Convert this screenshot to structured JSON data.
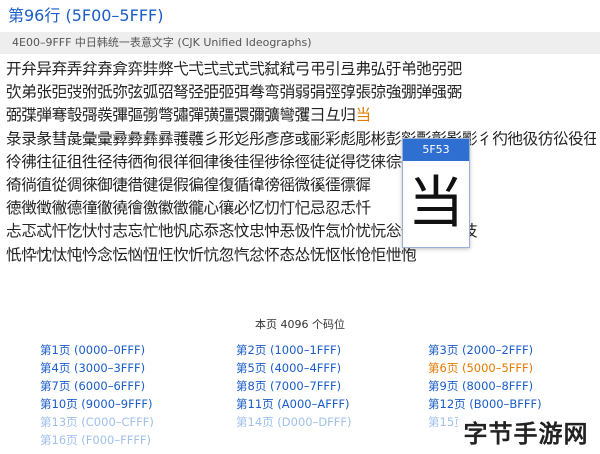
{
  "header": {
    "title": "第96行  (5F00–5FFF)",
    "subtitle": "4E00–9FFF 中日韩统一表意文字 (CJK Unified Ideographs)"
  },
  "grid": {
    "lines": [
      "开弁异弃弄弅弆弇弈弉弊弋弌弍弎式弐弑弒弓弔引弖弗弘弙弚弛弜弝",
      "弞弟张弡弢弣弤弥弦弧弨弩弪弫弬弭弮弯弰弱弲弳弴張弶強弸弹强弻",
      "弼弽弾弿彀彁彂彃彄彅彆彇彈彉彊彋彌彍彎彏彐彑归",
      "彔录彖彗彘彙彚彛彜彝彞彟彠彡形彣彤彥彦彧彨彩彪彫彬彭彮彯彰影彲彳彴彵彶彷彸役彺彻彼彽",
      "彾彿往征徂徃径待徆徇很徉徊律後徍徎徏徐徑徒従得徔徕徖得徘徙徚",
      "徛徜徝從徟徠御徢徣徤徥徦徧徨復循徫徬徭微徯徰徱徲",
      "徳徴徵徶德徸徹徺徻徼徽徾徿心忀必忆忉忊忋忌忍忎忏",
      "忐忑忒忓忔忕忖志忘忙忚忛応忝忞忟忠忡忢忣忤忥忦忧忨忩忪快忬忭忮",
      "忯忰忱忲忳忴念忶忷忸忹忺忻忼忽忾忿怀态怂怃怄怅怆怇怈怉"
    ],
    "highlight_char": "当"
  },
  "popup": {
    "code": "5F53",
    "char": "当"
  },
  "summary": {
    "count_text": "本页 4096 个码位"
  },
  "pages": [
    {
      "label": "第1页  (0000–0FFF)",
      "state": "normal"
    },
    {
      "label": "第2页  (1000–1FFF)",
      "state": "normal"
    },
    {
      "label": "第3页  (2000–2FFF)",
      "state": "normal"
    },
    {
      "label": "第4页  (3000–3FFF)",
      "state": "normal"
    },
    {
      "label": "第5页  (4000–4FFF)",
      "state": "normal"
    },
    {
      "label": "第6页  (5000–5FFF)",
      "state": "current"
    },
    {
      "label": "第7页  (6000–6FFF)",
      "state": "normal"
    },
    {
      "label": "第8页  (7000–7FFF)",
      "state": "normal"
    },
    {
      "label": "第9页  (8000–8FFF)",
      "state": "normal"
    },
    {
      "label": "第10页  (9000–9FFF)",
      "state": "normal"
    },
    {
      "label": "第11页  (A000–AFFF)",
      "state": "normal"
    },
    {
      "label": "第12页  (B000–BFFF)",
      "state": "normal"
    },
    {
      "label": "第13页  (C000–CFFF)",
      "state": "faded"
    },
    {
      "label": "第14页  (D000–DFFF)",
      "state": "faded"
    },
    {
      "label": "第15页  (E000–EFFF)",
      "state": "faded"
    },
    {
      "label": "第16页  (F000–FFFF)",
      "state": "faded"
    }
  ],
  "watermark": {
    "text": "字节手游网"
  },
  "colors": {
    "link": "#1a5cc8",
    "current": "#e07b00",
    "faded": "#9fc0ea",
    "popup_header": "#2f6fd1"
  }
}
